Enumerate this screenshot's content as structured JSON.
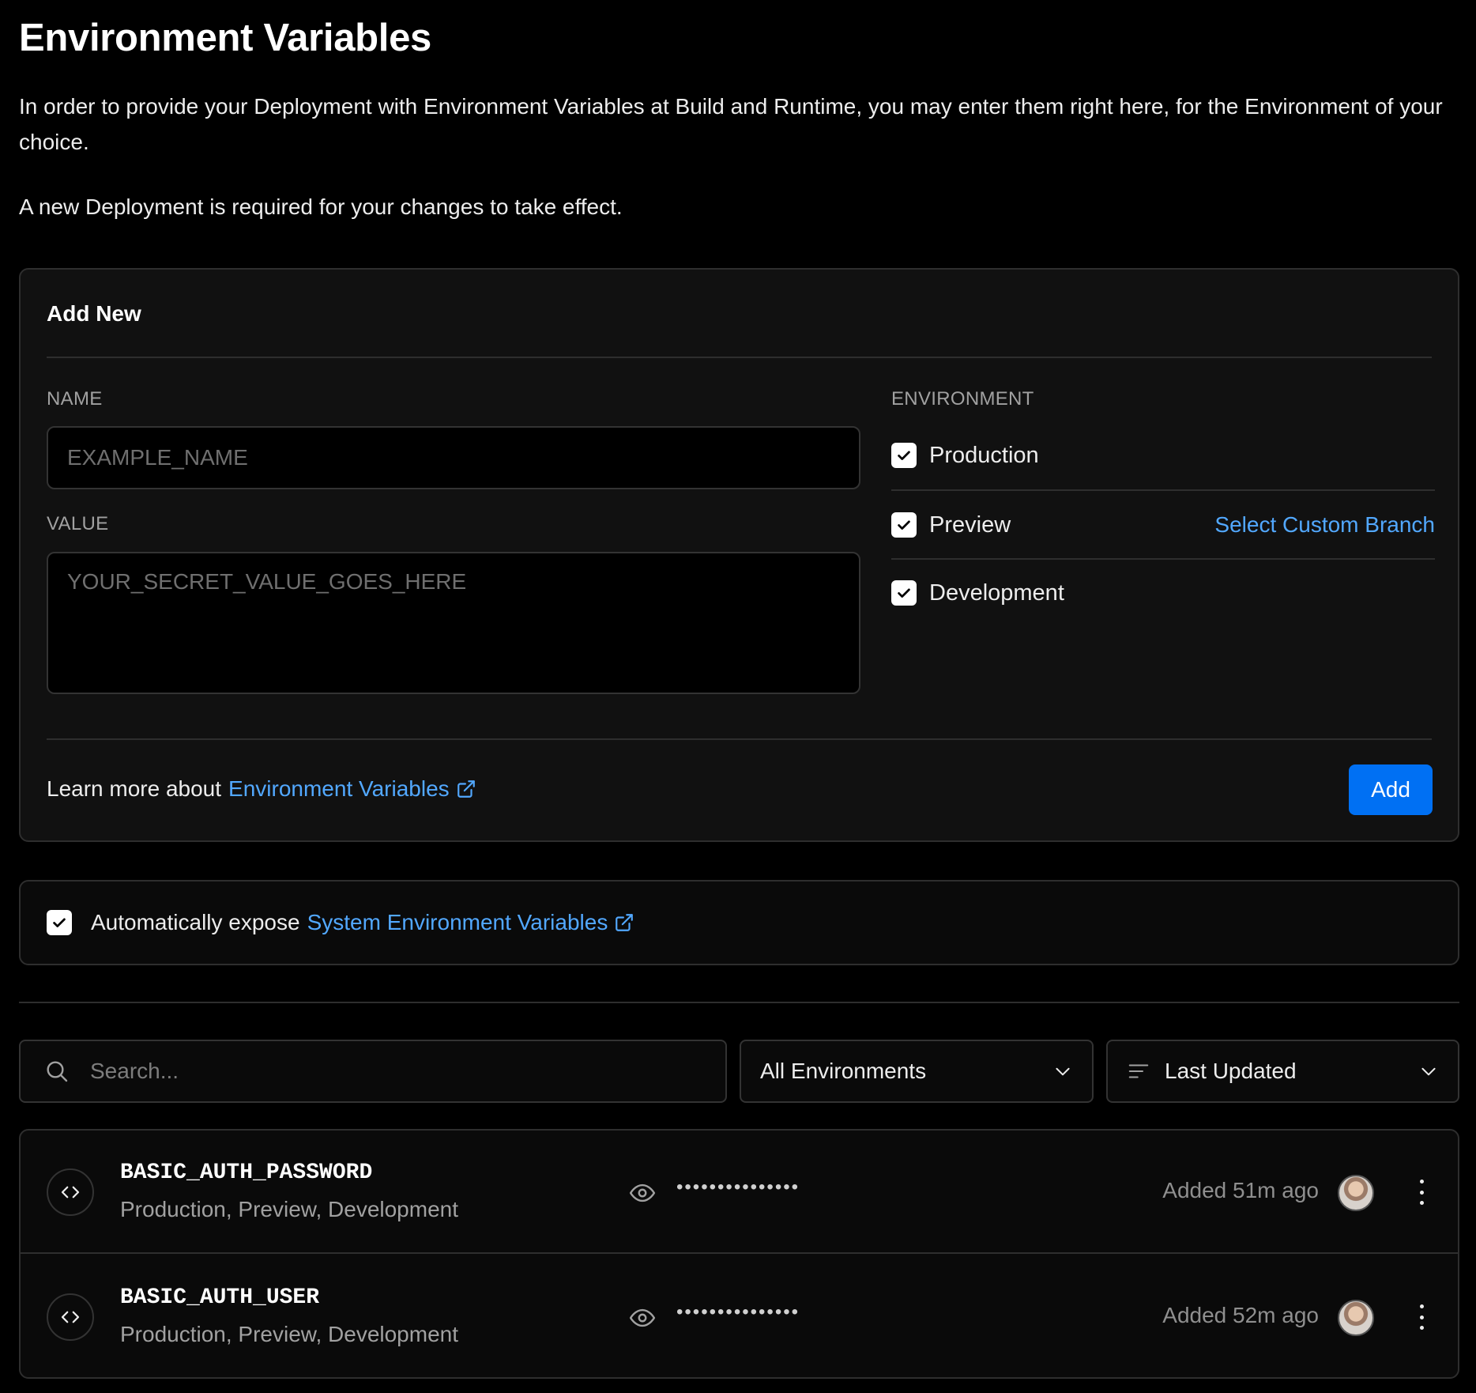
{
  "page": {
    "title": "Environment Variables",
    "description": "In order to provide your Deployment with Environment Variables at Build and Runtime, you may enter them right here, for the Environment of your choice.",
    "note": "A new Deployment is required for your changes to take effect."
  },
  "add_new": {
    "title": "Add New",
    "name_label": "NAME",
    "name_placeholder": "EXAMPLE_NAME",
    "value_label": "VALUE",
    "value_placeholder": "YOUR_SECRET_VALUE_GOES_HERE",
    "environment_label": "ENVIRONMENT",
    "environments": [
      {
        "label": "Production",
        "checked": true
      },
      {
        "label": "Preview",
        "checked": true
      },
      {
        "label": "Development",
        "checked": true
      }
    ],
    "custom_branch_link": "Select Custom Branch",
    "learn_more_prefix": "Learn more about",
    "learn_more_link": "Environment Variables",
    "add_button": "Add"
  },
  "expose": {
    "checked": true,
    "prefix": "Automatically expose",
    "link": "System Environment Variables"
  },
  "filters": {
    "search_placeholder": "Search...",
    "environment_select": "All Environments",
    "sort_select": "Last Updated"
  },
  "variables": [
    {
      "name": "BASIC_AUTH_PASSWORD",
      "environments": "Production, Preview, Development",
      "masked_value": "•••••••••••••••",
      "added": "Added 51m ago"
    },
    {
      "name": "BASIC_AUTH_USER",
      "environments": "Production, Preview, Development",
      "masked_value": "•••••••••••••••",
      "added": "Added 52m ago"
    }
  ],
  "colors": {
    "background": "#000000",
    "card": "#111111",
    "border": "#2e2e2e",
    "link": "#52a8ff",
    "primary_button": "#0070f3"
  }
}
